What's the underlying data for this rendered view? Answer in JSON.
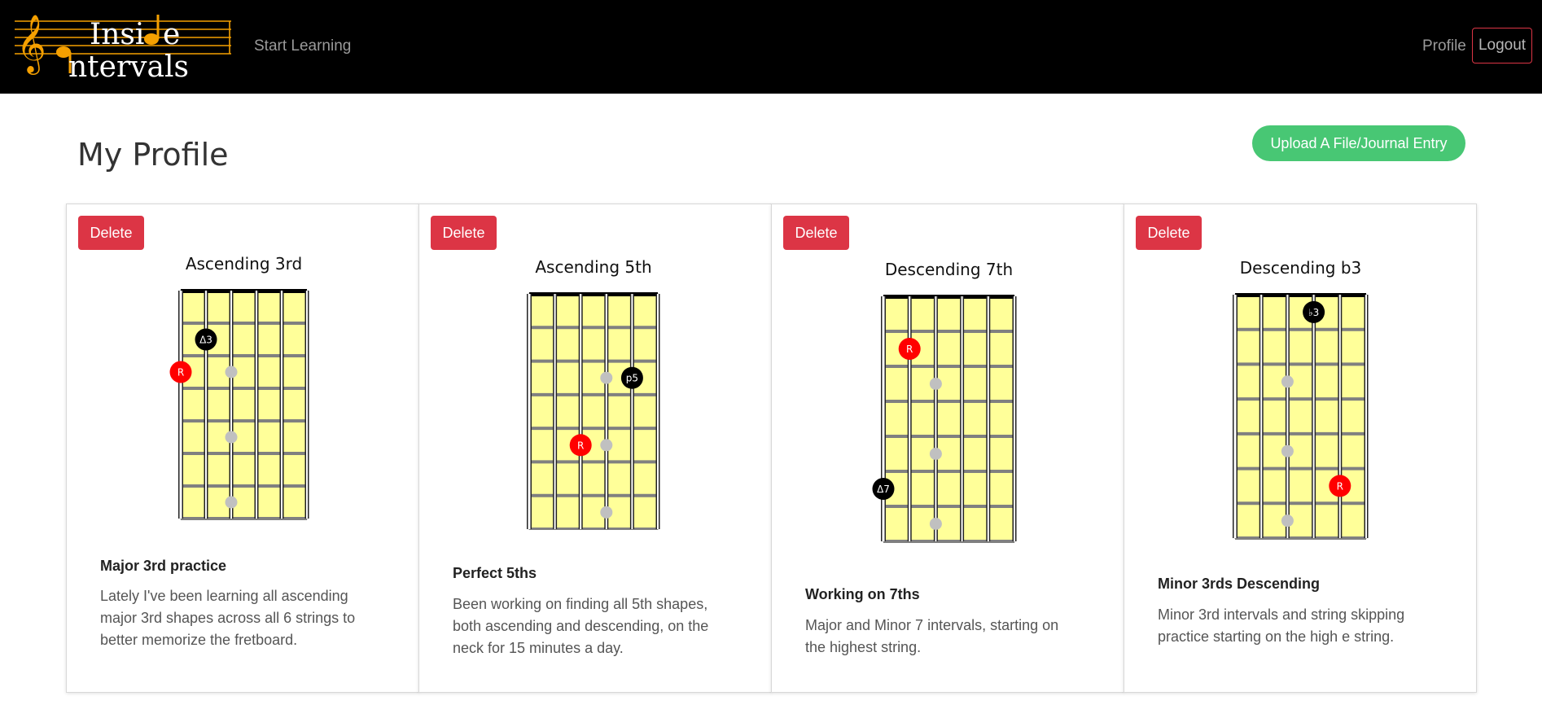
{
  "brand": {
    "line1": "Insi",
    "line1_tail": "e",
    "line2": "ntervals",
    "accent": "#f5a000"
  },
  "nav": {
    "start_learning": "Start Learning",
    "profile": "Profile",
    "logout": "Logout"
  },
  "page": {
    "title": "My Profile",
    "upload_button": "Upload A File/Journal Entry"
  },
  "colors": {
    "fret_fill": "#ffff99",
    "root_dot": "#ff0000",
    "interval_dot": "#000000",
    "ghost_dot": "#c0c0c0",
    "delete_button": "#dc3545",
    "upload_button": "#48c774"
  },
  "cards": [
    {
      "delete_label": "Delete",
      "diagram_title": "Ascending 3rd",
      "notes": [
        {
          "label": "Δ3",
          "type": "interval",
          "string": 2,
          "fret": 2
        },
        {
          "label": "R",
          "type": "root",
          "string": 1,
          "fret": 3
        },
        {
          "label": "",
          "type": "ghost",
          "string": 3,
          "fret": 3
        },
        {
          "label": "",
          "type": "ghost",
          "string": 3,
          "fret": 5
        },
        {
          "label": "",
          "type": "ghost",
          "string": 3,
          "fret": 7
        }
      ],
      "entry_title": "Major 3rd practice",
      "entry_desc": "Lately I've been learning all ascending major 3rd shapes across all 6 strings to better memorize the fretboard."
    },
    {
      "delete_label": "Delete",
      "diagram_title": "Ascending 5th",
      "notes": [
        {
          "label": "p5",
          "type": "interval",
          "string": 5,
          "fret": 3
        },
        {
          "label": "",
          "type": "ghost",
          "string": 4,
          "fret": 3
        },
        {
          "label": "",
          "type": "ghost",
          "string": 4,
          "fret": 5
        },
        {
          "label": "R",
          "type": "root",
          "string": 3,
          "fret": 5
        },
        {
          "label": "",
          "type": "ghost",
          "string": 4,
          "fret": 7
        }
      ],
      "entry_title": "Perfect 5ths",
      "entry_desc": "Been working on finding all 5th shapes, both ascending and descending, on the neck for 15 minutes a day."
    },
    {
      "delete_label": "Delete",
      "diagram_title": "Descending 7th",
      "notes": [
        {
          "label": "R",
          "type": "root",
          "string": 2,
          "fret": 2
        },
        {
          "label": "",
          "type": "ghost",
          "string": 3,
          "fret": 3
        },
        {
          "label": "",
          "type": "ghost",
          "string": 3,
          "fret": 5
        },
        {
          "label": "Δ7",
          "type": "interval",
          "string": 1,
          "fret": 6
        },
        {
          "label": "",
          "type": "ghost",
          "string": 3,
          "fret": 7
        }
      ],
      "entry_title": "Working on 7ths",
      "entry_desc": "Major and Minor 7 intervals, starting on the highest string."
    },
    {
      "delete_label": "Delete",
      "diagram_title": "Descending b3",
      "notes": [
        {
          "label": "♭3",
          "type": "interval",
          "string": 4,
          "fret": 1
        },
        {
          "label": "",
          "type": "ghost",
          "string": 3,
          "fret": 3
        },
        {
          "label": "",
          "type": "ghost",
          "string": 3,
          "fret": 5
        },
        {
          "label": "R",
          "type": "root",
          "string": 5,
          "fret": 6
        },
        {
          "label": "",
          "type": "ghost",
          "string": 3,
          "fret": 7
        }
      ],
      "entry_title": "Minor 3rds Descending",
      "entry_desc": "Minor 3rd intervals and string skipping practice starting on the high e string."
    }
  ]
}
